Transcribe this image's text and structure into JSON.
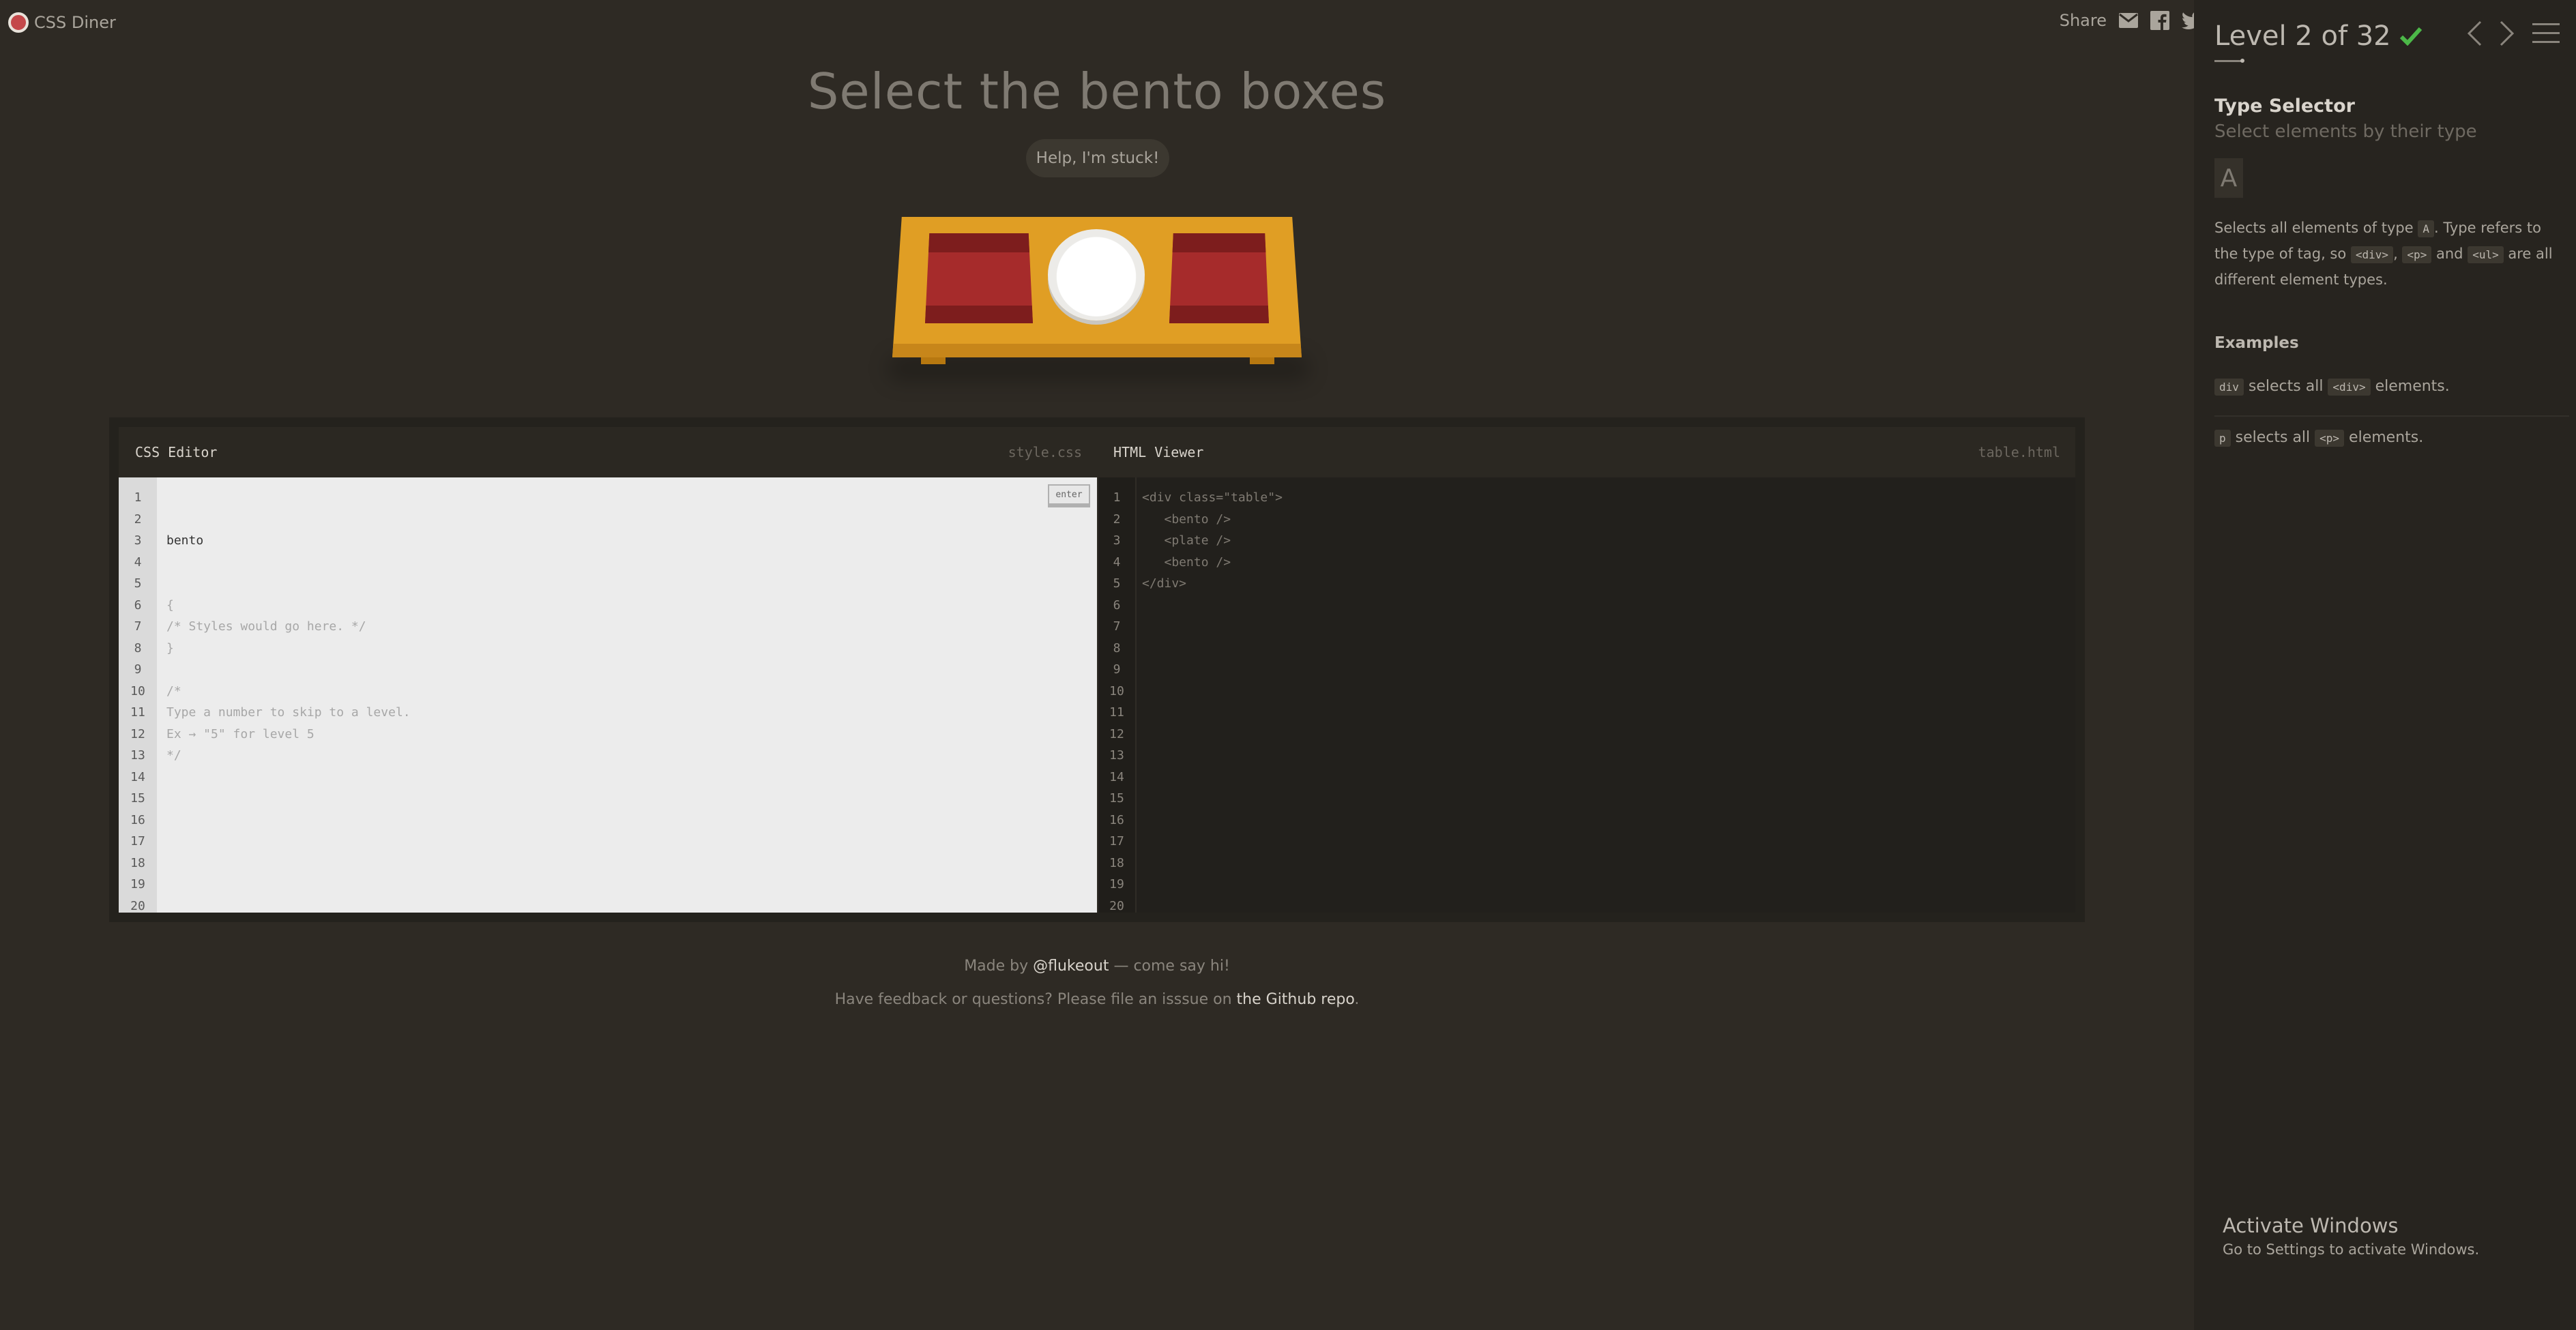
{
  "app": {
    "name": "CSS Diner"
  },
  "share": {
    "label": "Share"
  },
  "game": {
    "instruction": "Select the bento boxes",
    "help_label": "Help, I'm stuck!"
  },
  "css_editor": {
    "title": "CSS Editor",
    "filename": "style.css",
    "enter_label": "enter",
    "typed_input": "bento",
    "lines": [
      "{",
      "/* Styles would go here. */",
      "}",
      "",
      "/*",
      "Type a number to skip to a level.",
      "Ex → \"5\" for level 5",
      "*/"
    ],
    "line_numbers": [
      "1",
      "2",
      "3",
      "4",
      "5",
      "6",
      "7",
      "8",
      "9",
      "10",
      "11",
      "12",
      "13",
      "14",
      "15",
      "16",
      "17",
      "18",
      "19",
      "20"
    ]
  },
  "html_viewer": {
    "title": "HTML Viewer",
    "filename": "table.html",
    "lines": [
      "<div class=\"table\">",
      "   <bento />",
      "   <plate />",
      "   <bento />",
      "</div>"
    ],
    "line_numbers": [
      "1",
      "2",
      "3",
      "4",
      "5",
      "6",
      "7",
      "8",
      "9",
      "10",
      "11",
      "12",
      "13",
      "14",
      "15",
      "16",
      "17",
      "18",
      "19",
      "20"
    ]
  },
  "footer": {
    "made_by_prefix": "Made by ",
    "made_by_link": "@flukeout",
    "made_by_suffix": " — come say hi!",
    "feedback_prefix": "Have feedback or questions? Please file an isssue on ",
    "feedback_link": "the Github repo",
    "feedback_suffix": "."
  },
  "sidebar": {
    "level_label": "Level 2 of 32",
    "level_progress": 0.0625,
    "completed": true,
    "selector_name": "Type Selector",
    "selector_title": "Select elements by their type",
    "syntax": "A",
    "description": {
      "part1": "Selects all elements of type ",
      "code1": "A",
      "part2": ". Type refers to the type of tag, so ",
      "code2": "<div>",
      "part3": ", ",
      "code3": "<p>",
      "part4": " and ",
      "code4": "<ul>",
      "part5": " are all different element types."
    },
    "examples_heading": "Examples",
    "examples": [
      {
        "code": "div",
        "mid": " selects all ",
        "code2": "<div>",
        "end": " elements."
      },
      {
        "code": "p",
        "mid": " selects all ",
        "code2": "<p>",
        "end": " elements."
      }
    ]
  },
  "windows_watermark": {
    "title": "Activate Windows",
    "subtitle": "Go to Settings to activate Windows."
  },
  "colors": {
    "background": "#2e2a24",
    "sidebar": "#27241f",
    "check": "#4cb848",
    "bento": "#a62b2b",
    "table": "#e09e24"
  }
}
